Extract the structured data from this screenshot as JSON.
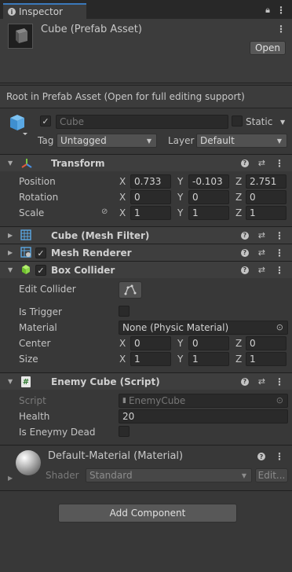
{
  "tab": {
    "label": "Inspector"
  },
  "header": {
    "title": "Cube (Prefab Asset)",
    "open_label": "Open"
  },
  "notice": "Root in Prefab Asset (Open for full editing support)",
  "object": {
    "name": "Cube",
    "static_label": "Static",
    "tag_label": "Tag",
    "tag_value": "Untagged",
    "layer_label": "Layer",
    "layer_value": "Default"
  },
  "transform": {
    "title": "Transform",
    "rows": [
      {
        "label": "Position",
        "x": "0.733",
        "y": "-0.103",
        "z": "2.751"
      },
      {
        "label": "Rotation",
        "x": "0",
        "y": "0",
        "z": "0"
      },
      {
        "label": "Scale",
        "x": "1",
        "y": "1",
        "z": "1"
      }
    ]
  },
  "axes": {
    "x": "X",
    "y": "Y",
    "z": "Z"
  },
  "mesh_filter": {
    "title": "Cube (Mesh Filter)"
  },
  "mesh_renderer": {
    "title": "Mesh Renderer"
  },
  "box_collider": {
    "title": "Box Collider",
    "edit_collider_label": "Edit Collider",
    "is_trigger_label": "Is Trigger",
    "material_label": "Material",
    "material_value": "None (Physic Material)",
    "center_label": "Center",
    "center": {
      "x": "0",
      "y": "0",
      "z": "0"
    },
    "size_label": "Size",
    "size": {
      "x": "1",
      "y": "1",
      "z": "1"
    }
  },
  "enemy_cube": {
    "title": "Enemy Cube (Script)",
    "script_label": "Script",
    "script_value": "EnemyCube",
    "health_label": "Health",
    "health_value": "20",
    "dead_label": "Is Eneymy Dead"
  },
  "material": {
    "title": "Default-Material (Material)",
    "shader_label": "Shader",
    "shader_value": "Standard",
    "edit_label": "Edit..."
  },
  "add_component_label": "Add Component",
  "colors": {
    "accent": "#3a79bb",
    "background": "#383838",
    "field": "#2a2a2a",
    "transform_icon": "#e05a3a",
    "collider_icon": "#8dd84a"
  }
}
